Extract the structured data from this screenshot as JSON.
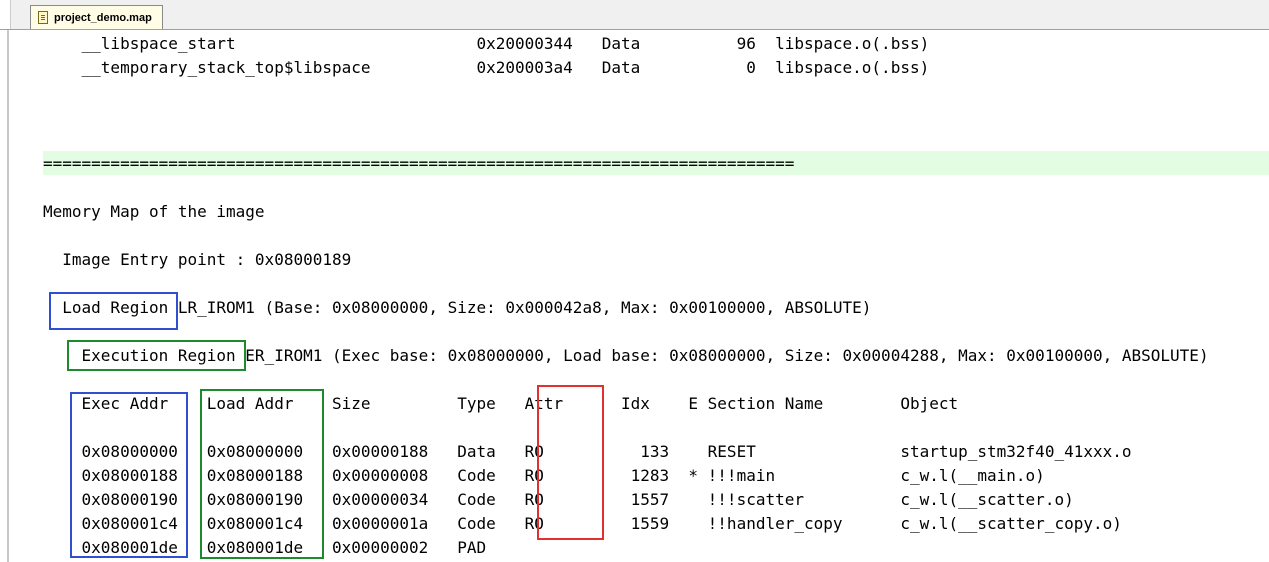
{
  "tab": {
    "title": "project_demo.map",
    "icon": "file-icon"
  },
  "lines": {
    "l1": "    __libspace_start                         0x20000344   Data          96  libspace.o(.bss)",
    "l2": "    __temporary_stack_top$libspace           0x200003a4   Data           0  libspace.o(.bss)",
    "l3": "==============================================================================",
    "l4": "Memory Map of the image",
    "l5": "  Image Entry point : 0x08000189",
    "l6": "  Load Region LR_IROM1 (Base: 0x08000000, Size: 0x000042a8, Max: 0x00100000, ABSOLUTE)",
    "l7": "    Execution Region ER_IROM1 (Exec base: 0x08000000, Load base: 0x08000000, Size: 0x00004288, Max: 0x00100000, ABSOLUTE)",
    "l8": "    Exec Addr    Load Addr    Size         Type   Attr      Idx    E Section Name        Object",
    "l9": "    0x08000000   0x08000000   0x00000188   Data   RO          133    RESET               startup_stm32f40_41xxx.o",
    "l10": "    0x08000188   0x08000188   0x00000008   Code   RO         1283  * !!!main             c_w.l(__main.o)",
    "l11": "    0x08000190   0x08000190   0x00000034   Code   RO         1557    !!!scatter          c_w.l(__scatter.o)",
    "l12": "    0x080001c4   0x080001c4   0x0000001a   Code   RO         1559    !!handler_copy      c_w.l(__scatter_copy.o)",
    "l13": "    0x080001de   0x080001de   0x00000002   PAD"
  }
}
